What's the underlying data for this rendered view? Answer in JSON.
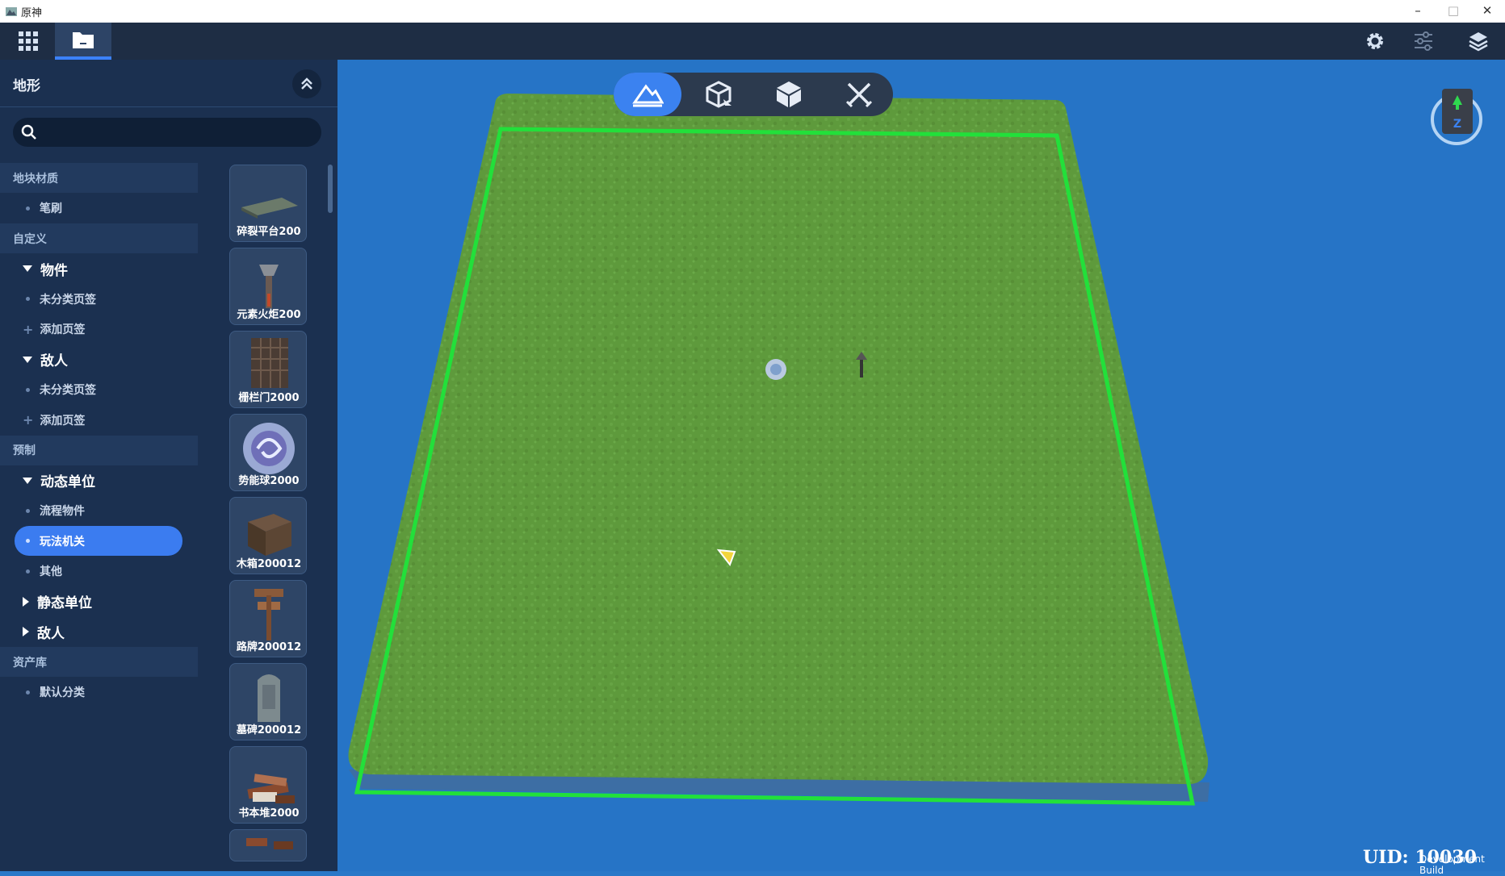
{
  "window": {
    "title": "原神",
    "minimize": "–",
    "maximize": "□",
    "close": "✕"
  },
  "topbar": {
    "left_icons": [
      "grid-icon",
      "folder-icon"
    ],
    "right_icons": [
      "settings-icon",
      "sliders-icon",
      "layers-icon"
    ]
  },
  "sidebar": {
    "title": "地形",
    "search": {
      "value": "",
      "placeholder": ""
    },
    "tree": [
      {
        "type": "section",
        "label": "地块材质"
      },
      {
        "type": "leaf",
        "label": "笔刷"
      },
      {
        "type": "section",
        "label": "自定义"
      },
      {
        "type": "group",
        "label": "物件",
        "expanded": true
      },
      {
        "type": "leaf",
        "label": "未分类页签"
      },
      {
        "type": "add",
        "label": "添加页签"
      },
      {
        "type": "group",
        "label": "敌人",
        "expanded": true
      },
      {
        "type": "leaf",
        "label": "未分类页签"
      },
      {
        "type": "add",
        "label": "添加页签"
      },
      {
        "type": "section",
        "label": "预制"
      },
      {
        "type": "group",
        "label": "动态单位",
        "expanded": true
      },
      {
        "type": "leaf",
        "label": "流程物件"
      },
      {
        "type": "leaf",
        "label": "玩法机关",
        "selected": true
      },
      {
        "type": "leaf",
        "label": "其他"
      },
      {
        "type": "group",
        "label": "静态单位",
        "expanded": false
      },
      {
        "type": "group",
        "label": "敌人",
        "expanded": false
      },
      {
        "type": "section",
        "label": "资产库"
      },
      {
        "type": "leaf",
        "label": "默认分类"
      }
    ],
    "assets": [
      {
        "label": "碎裂平台200",
        "icon": "cracked-platform-icon"
      },
      {
        "label": "元素火炬200",
        "icon": "element-torch-icon"
      },
      {
        "label": "栅栏门2000",
        "icon": "fence-gate-icon"
      },
      {
        "label": "势能球2000",
        "icon": "energy-orb-icon"
      },
      {
        "label": "木箱200012",
        "icon": "wooden-crate-icon"
      },
      {
        "label": "路牌200012",
        "icon": "signpost-icon"
      },
      {
        "label": "墓碑200012",
        "icon": "tombstone-icon"
      },
      {
        "label": "书本堆2000",
        "icon": "book-pile-icon"
      },
      {
        "label": "",
        "icon": "partial-asset-icon"
      }
    ]
  },
  "viewport": {
    "tools": [
      "terrain-tool-icon",
      "object-tool-icon",
      "cube-tool-icon",
      "combat-tool-icon"
    ],
    "active_tool": 0,
    "uid": "UID: 10030",
    "build_label": "Development Build",
    "compass_letter": "Z"
  },
  "colors": {
    "accent": "#3b82f0",
    "grass": "#5e9a3c",
    "boundary": "#22e03a",
    "viewport_bg": "#2674c6",
    "sidebar_bg": "#1b3050"
  }
}
